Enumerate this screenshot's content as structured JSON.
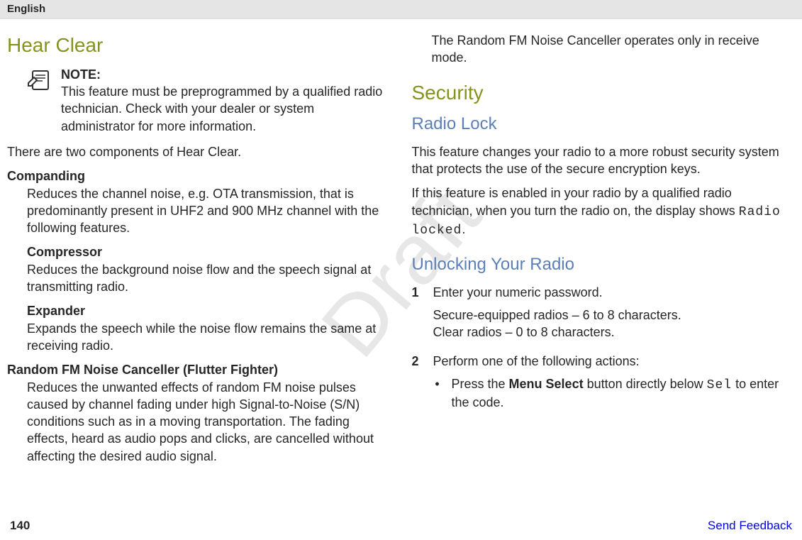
{
  "header": {
    "language": "English"
  },
  "watermark": "Draft",
  "left": {
    "title": "Hear Clear",
    "note": {
      "label": "NOTE:",
      "text": "This feature must be preprogrammed by a qualified radio technician. Check with your dealer or system administrator for more information."
    },
    "intro": "There are two components of Hear Clear.",
    "companding": {
      "term": "Companding",
      "desc": "Reduces the channel noise, e.g. OTA transmission, that is predominantly present in UHF2 and 900 MHz channel with the following features.",
      "compressor": {
        "term": "Compressor",
        "desc": "Reduces the background noise flow and the speech signal at transmitting radio."
      },
      "expander": {
        "term": "Expander",
        "desc": "Expands the speech while the noise flow remains the same at receiving radio."
      }
    },
    "flutter": {
      "term": "Random FM Noise Canceller (Flutter Fighter)",
      "desc": "Reduces the unwanted effects of random FM noise pulses caused by channel fading under high Signal-to-Noise (S/N) conditions such as in a moving transportation. The fading effects, heard as audio pops and clicks, are cancelled without affecting the desired audio signal."
    }
  },
  "right": {
    "flutter_cont": "The Random FM Noise Canceller operates only in receive mode.",
    "security_title": "Security",
    "radio_lock": {
      "title": "Radio Lock",
      "p1": "This feature changes your radio to a more robust security system that protects the use of the secure encryption keys.",
      "p2a": "If this feature is enabled in your radio by a qualified radio technician, when you turn the radio on, the display shows ",
      "p2_code": "Radio locked",
      "p2b": "."
    },
    "unlock": {
      "title": "Unlocking Your Radio",
      "step1": {
        "num": "1",
        "text": "Enter your numeric password.",
        "sub1": "Secure-equipped radios – 6 to 8 characters.",
        "sub2": "Clear radios – 0 to 8 characters."
      },
      "step2": {
        "num": "2",
        "text": "Perform one of the following actions:",
        "bullet_a": "Press the ",
        "bullet_bold": "Menu Select",
        "bullet_b": " button directly below ",
        "bullet_code": "Sel",
        "bullet_c": " to enter the code."
      }
    }
  },
  "footer": {
    "page": "140",
    "feedback": "Send Feedback"
  }
}
